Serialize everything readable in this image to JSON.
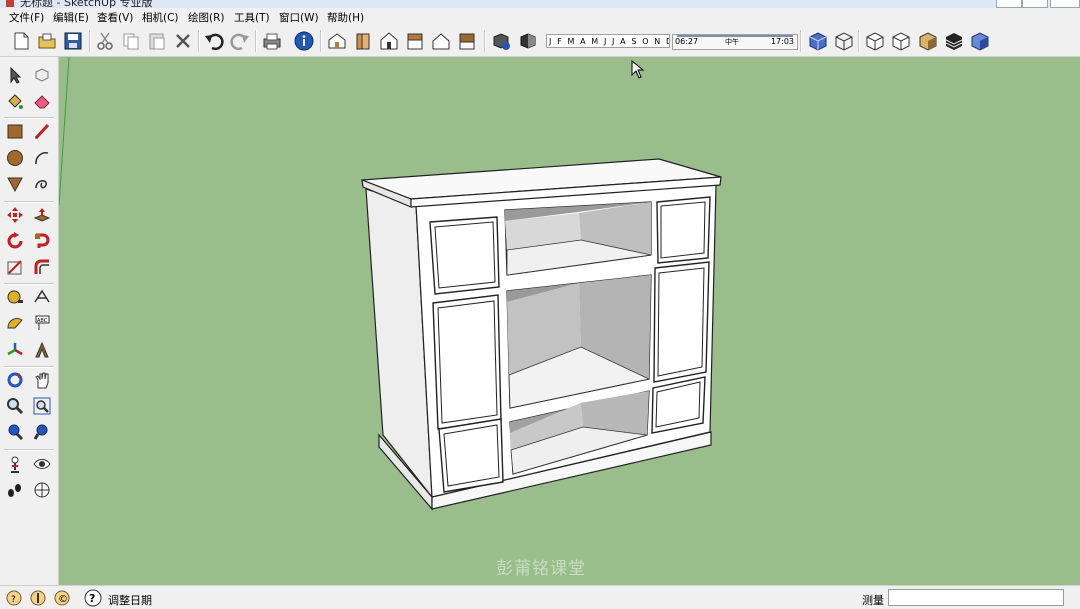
{
  "window": {
    "title": "无标题 - SketchUp 专业版"
  },
  "menu": [
    "文件(F)",
    "编辑(E)",
    "查看(V)",
    "相机(C)",
    "绘图(R)",
    "工具(T)",
    "窗口(W)",
    "帮助(H)"
  ],
  "toolbar": {
    "icons": [
      "new-file-icon",
      "open-folder-icon",
      "save-icon",
      "cut-icon",
      "copy-icon",
      "paste-icon",
      "erase-x-icon",
      "undo-icon",
      "redo-icon",
      "print-icon",
      "model-info-icon",
      "iso-view-icon",
      "front-view-icon",
      "top-view-icon",
      "right-view-icon",
      "back-view-icon",
      "left-view-icon",
      "shadow-settings-icon",
      "shadow-toggle-icon",
      "xray-style-icon",
      "wireframe-style-icon",
      "hidden-line-style-icon",
      "shaded-style-icon",
      "shaded-texture-style-icon",
      "monochrome-style-icon"
    ],
    "months": "J F M A M J J A S O N D",
    "time_start": "06:27",
    "time_mid": "中午",
    "time_end": "17:03"
  },
  "tools": [
    "select-icon",
    "make-component-icon",
    "paint-bucket-icon",
    "eraser-icon",
    "rectangle-icon",
    "line-icon",
    "circle-icon",
    "arc-icon",
    "polygon-icon",
    "freehand-icon",
    "move-icon",
    "push-pull-icon",
    "rotate-icon",
    "follow-me-icon",
    "scale-icon",
    "offset-icon",
    "tape-measure-icon",
    "dimension-icon",
    "protractor-icon",
    "text-icon",
    "axes-icon",
    "3d-text-icon",
    "orbit-icon",
    "pan-icon",
    "zoom-icon",
    "zoom-window-icon",
    "zoom-extents-icon",
    "previous-view-icon",
    "position-camera-icon",
    "look-around-icon",
    "walk-icon",
    "section-plane-icon"
  ],
  "watermark": "彭莆铭课堂",
  "status": {
    "text": "调整日期",
    "measure_label": "测量",
    "measure_value": ""
  },
  "colors": {
    "viewport": "#9abe8b",
    "chrome": "#f0f0f0"
  }
}
